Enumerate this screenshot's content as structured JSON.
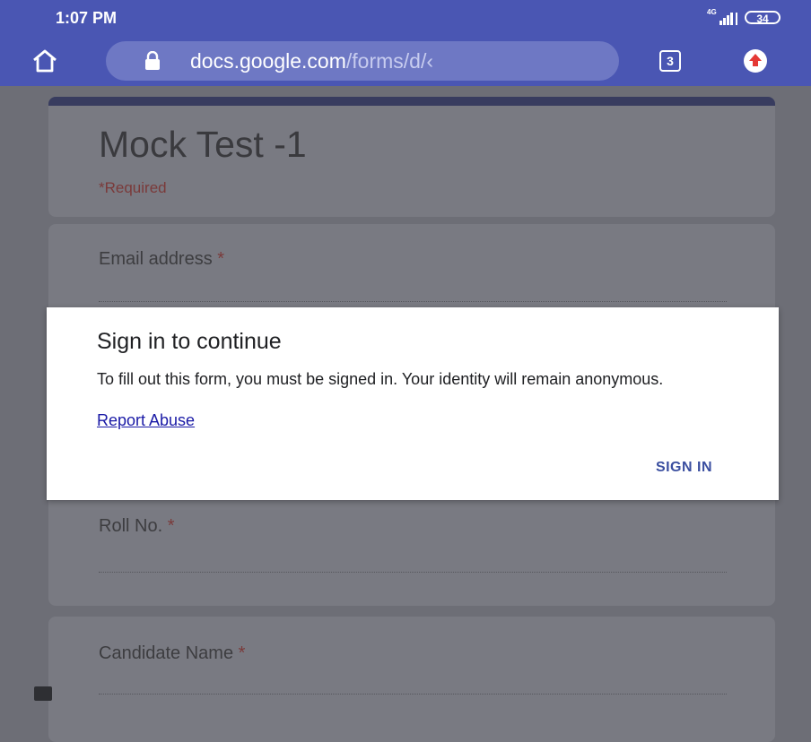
{
  "status": {
    "time": "1:07 PM",
    "network": "4G",
    "battery": "34"
  },
  "browser": {
    "url_host": "docs.google.com",
    "url_path": "/forms/d/‹",
    "tab_count": "3"
  },
  "form": {
    "title": "Mock Test -1",
    "required_note": "*Required",
    "questions": [
      {
        "label": "Email address",
        "required_mark": "*"
      },
      {
        "label": "Roll No.",
        "required_mark": "*"
      },
      {
        "label": "Candidate Name",
        "required_mark": "*"
      }
    ]
  },
  "dialog": {
    "title": "Sign in to continue",
    "body": "To fill out this form, you must be signed in. Your identity will remain anonymous.",
    "link": "Report Abuse",
    "button": "SIGN IN"
  },
  "colors": {
    "chrome": "#4a56b3",
    "dialog_button": "#3b4fa0",
    "link": "#1a1aa6"
  }
}
